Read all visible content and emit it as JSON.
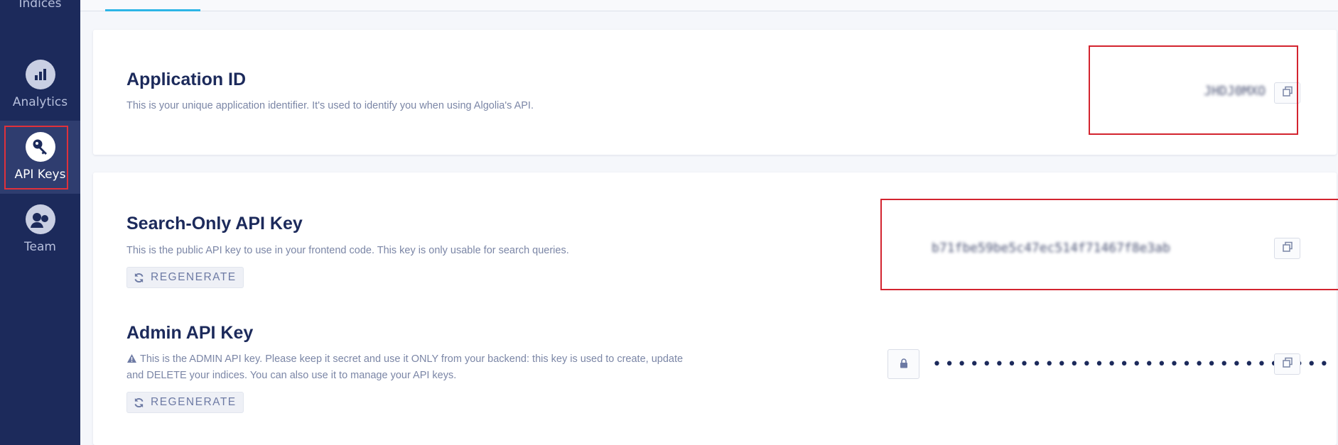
{
  "sidebar": {
    "items": [
      {
        "label": "Indices",
        "icon": "database-icon"
      },
      {
        "label": "Analytics",
        "icon": "bar-chart-icon"
      },
      {
        "label": "API Keys",
        "icon": "key-icon",
        "active": true
      },
      {
        "label": "Team",
        "icon": "team-icon"
      }
    ]
  },
  "application_id": {
    "title": "Application ID",
    "description": "This is your unique application identifier. It's used to identify you when using Algolia's API.",
    "value": "JHDJ0MXO"
  },
  "search_key": {
    "title": "Search-Only API Key",
    "description": "This is the public API key to use in your frontend code. This key is only usable for search queries.",
    "regenerate_label": "REGENERATE",
    "value": "b71fbe59be5c47ec514f71467f8e3ab"
  },
  "admin_key": {
    "title": "Admin API Key",
    "description_line1": "This is the ADMIN API key. Please keep it secret and use it ONLY from your backend: this key is used to create, update",
    "description_line2": "and DELETE your indices. You can also use it to manage your API keys.",
    "regenerate_label": "REGENERATE",
    "masked_value": "••••••••••••••••••••••••••••••••"
  },
  "colors": {
    "sidebar_bg": "#1c2a5b",
    "accent": "#2db5e6",
    "highlight": "#d3242f"
  }
}
